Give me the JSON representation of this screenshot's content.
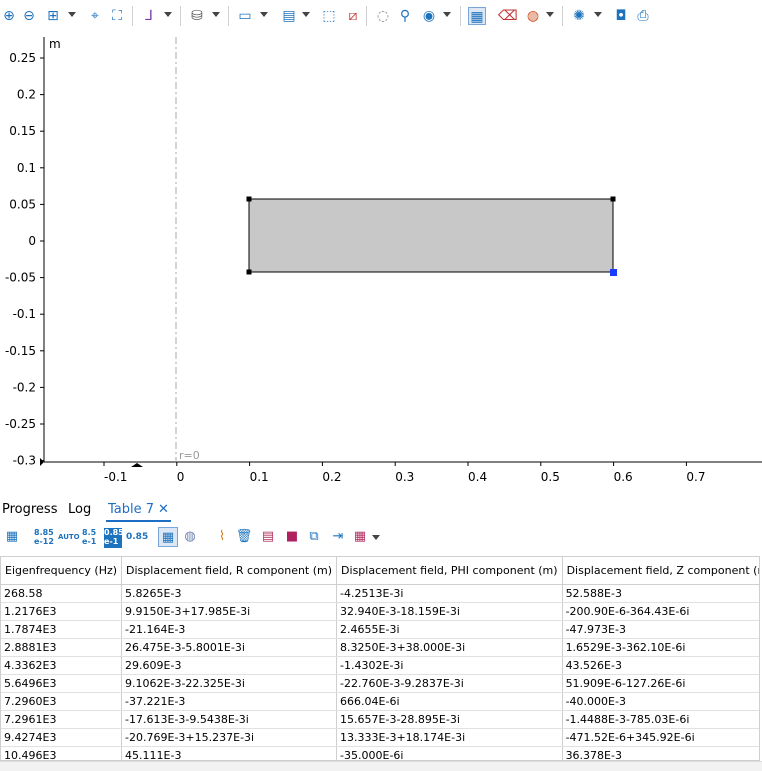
{
  "toolbar": {
    "icons": [
      "zoom-in-icon",
      "zoom-out-icon",
      "zoom-box-icon",
      "zoom-extents-icon",
      "zoom-selection-icon",
      "axis-orientation-icon",
      "views-icon",
      "select-objects-icon",
      "selection-mode-icon",
      "select-box-icon",
      "deselect-box-icon",
      "hide-icon",
      "show-icon",
      "view-settings-icon",
      "table-icon",
      "clear-icon",
      "color-palette-icon",
      "lock-view-icon",
      "camera-icon",
      "print-icon"
    ]
  },
  "plot": {
    "unit_label": "m",
    "y_ticks": [
      "0.25",
      "0.2",
      "0.15",
      "0.1",
      "0.05",
      "0",
      "-0.05",
      "-0.1",
      "-0.15",
      "-0.2",
      "-0.25",
      "-0.3"
    ],
    "x_ticks": [
      "-0.1",
      "0",
      "0.1",
      "0.2",
      "0.3",
      "0.4",
      "0.5",
      "0.6",
      "0.7"
    ],
    "axis_label": "r=0",
    "geometry_color": "#c8c8c8"
  },
  "tabs": [
    {
      "label": "Progress"
    },
    {
      "label": "Log"
    },
    {
      "label": "Table 7",
      "close": "✕"
    }
  ],
  "table_toolbar": {
    "format_a_top": "8.85",
    "format_a_bottom": "e-12",
    "format_auto": "AUTO",
    "format_b_top": "8.5",
    "format_b_bottom": "e-1",
    "format_c_top": "0.85",
    "format_c_bottom": "e-1",
    "format_value": "0.85"
  },
  "table": {
    "headers": [
      "Eigenfrequency (Hz)",
      "Displacement field, R component (m)",
      "Displacement field, PHI component (m)",
      "Displacement field, Z component (m),"
    ],
    "rows": [
      [
        "268.58",
        "5.8265E-3",
        "-4.2513E-3i",
        "52.588E-3"
      ],
      [
        "1.2176E3",
        "9.9150E-3+17.985E-3i",
        "32.940E-3-18.159E-3i",
        "-200.90E-6-364.43E-6i"
      ],
      [
        "1.7874E3",
        "-21.164E-3",
        "2.4655E-3i",
        "-47.973E-3"
      ],
      [
        "2.8881E3",
        "26.475E-3-5.8001E-3i",
        "8.3250E-3+38.000E-3i",
        "1.6529E-3-362.10E-6i"
      ],
      [
        "4.3362E3",
        "29.609E-3",
        "-1.4302E-3i",
        "43.526E-3"
      ],
      [
        "5.6496E3",
        "9.1062E-3-22.325E-3i",
        "-22.760E-3-9.2837E-3i",
        "51.909E-6-127.26E-6i"
      ],
      [
        "7.2960E3",
        "-37.221E-3",
        "666.04E-6i",
        "-40.000E-3"
      ],
      [
        "7.2961E3",
        "-17.613E-3-9.5438E-3i",
        "15.657E-3-28.895E-3i",
        "-1.4488E-3-785.03E-6i"
      ],
      [
        "9.4274E3",
        "-20.769E-3+15.237E-3i",
        "13.333E-3+18.174E-3i",
        "-471.52E-6+345.92E-6i"
      ],
      [
        "10.496E3",
        "45.111E-3",
        "-35.000E-6i",
        "36.378E-3"
      ]
    ]
  }
}
